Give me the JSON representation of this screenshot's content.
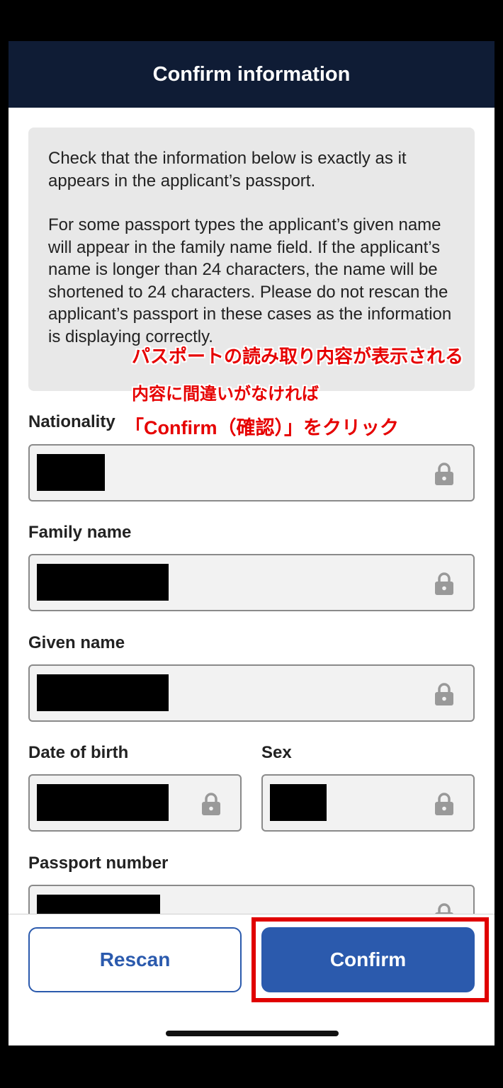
{
  "header": {
    "title": "Confirm information"
  },
  "info": {
    "paragraph1": "Check that the information below is exactly as it appears in the applicant’s passport.",
    "paragraph2": "For some passport types the applicant’s given name will appear in the family name field. If the applicant’s name is longer than 24 characters, the name will be shortened to 24 characters. Please do not rescan the applicant’s passport in these cases as the information is displaying correctly."
  },
  "fields": {
    "nationality": {
      "label": "Nationality"
    },
    "family_name": {
      "label": "Family name"
    },
    "given_name": {
      "label": "Given name"
    },
    "date_of_birth": {
      "label": "Date of birth"
    },
    "sex": {
      "label": "Sex"
    },
    "passport_number": {
      "label": "Passport number"
    }
  },
  "buttons": {
    "rescan": "Rescan",
    "confirm": "Confirm"
  },
  "annotation": {
    "line1": "パスポートの読み取り内容が表示される",
    "line2": "内容に間違いがなければ",
    "line3": "「Confirm（確認）」をクリック"
  },
  "colors": {
    "header_bg": "#0f1c35",
    "primary": "#2b5aad",
    "annotation": "#e60000"
  },
  "icons": {
    "field_lock": "lock-icon"
  }
}
